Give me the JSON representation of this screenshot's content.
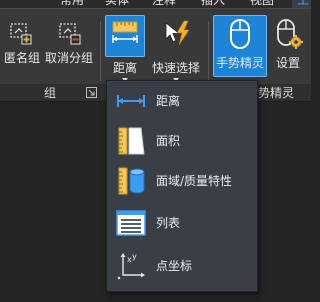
{
  "ribbon_tabs": [
    "常用",
    "实体",
    "注释",
    "插入",
    "视图",
    "工"
  ],
  "buttons": {
    "anonymous_group": "匿名组",
    "ungroup": "取消分组",
    "distance": "距离",
    "quick_select": "快速选择",
    "gesture_wizard": "手势精灵",
    "settings": "设置"
  },
  "panels": {
    "group": "组",
    "gesture_partial": "势精灵"
  },
  "menu": {
    "items": [
      {
        "label": "距离",
        "icon": "distance-icon"
      },
      {
        "label": "面积",
        "icon": "area-icon"
      },
      {
        "label": "面域/质量特性",
        "icon": "region-mass-properties-icon"
      },
      {
        "label": "列表",
        "icon": "list-icon"
      },
      {
        "label": "点坐标",
        "icon": "point-coordinates-icon"
      }
    ]
  },
  "colors": {
    "accent": "#1e84d8",
    "ribbon_bg": "#393939",
    "menu_bg": "#3a3f47",
    "icon_gold": "#e8b33a",
    "icon_blue": "#3c9cf0"
  }
}
